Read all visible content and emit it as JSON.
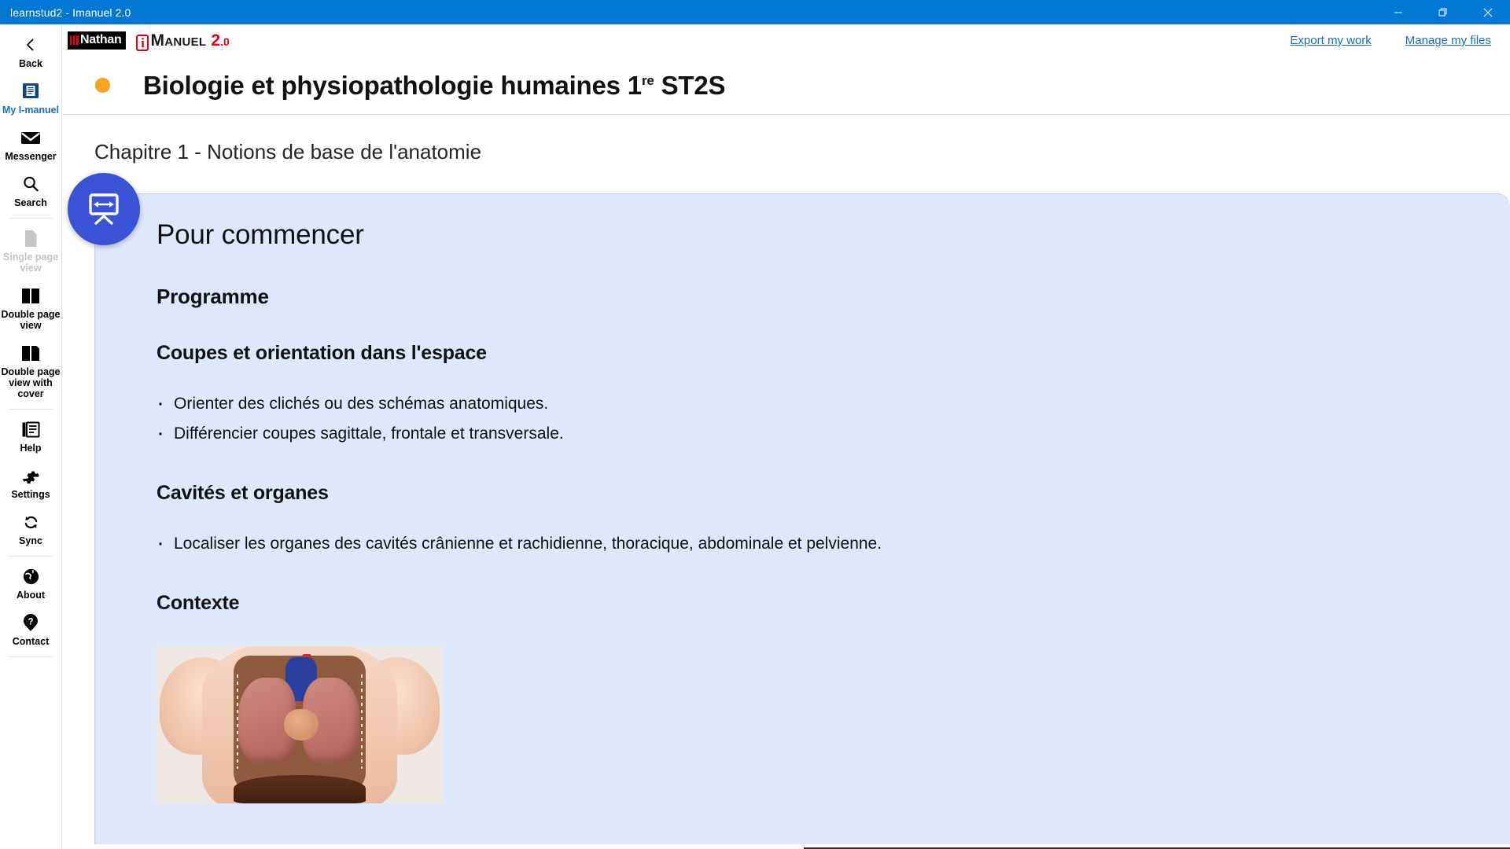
{
  "window": {
    "title": "learnstud2 - Imanuel 2.0",
    "controls": [
      {
        "name": "minimize",
        "glyph": "minimize-icon"
      },
      {
        "name": "restore",
        "glyph": "restore-icon"
      },
      {
        "name": "close",
        "glyph": "close-icon"
      }
    ],
    "titlebar_color": "#0078d4"
  },
  "sidebar": {
    "items": [
      {
        "label": "Back",
        "icon": "chevron-left-icon",
        "state": "normal"
      },
      {
        "label": "My I-manuel",
        "icon": "book-icon",
        "state": "active"
      },
      {
        "label": "Messenger",
        "icon": "envelope-icon",
        "state": "normal"
      },
      {
        "label": "Search",
        "icon": "search-icon",
        "state": "normal"
      },
      {
        "label": "Single page view",
        "icon": "single-page-icon",
        "state": "disabled"
      },
      {
        "label": "Double page view",
        "icon": "double-page-icon",
        "state": "normal"
      },
      {
        "label": "Double page view with cover",
        "icon": "double-page-cover-icon",
        "state": "normal"
      },
      {
        "label": "Help",
        "icon": "help-book-icon",
        "state": "normal"
      },
      {
        "label": "Settings",
        "icon": "gear-icon",
        "state": "normal"
      },
      {
        "label": "Sync",
        "icon": "sync-icon",
        "state": "normal"
      },
      {
        "label": "About",
        "icon": "globe-icon",
        "state": "normal"
      },
      {
        "label": "Contact",
        "icon": "question-mark-icon",
        "state": "normal"
      }
    ],
    "active_color": "#1a6fc4",
    "disabled_color": "#c6c6c6"
  },
  "header": {
    "brand": {
      "publisher": "Nathan",
      "product_i": "i",
      "product_word": "Manuel",
      "product_version_major": "2",
      "product_version_minor": ".0",
      "accent_color": "#e2001a"
    },
    "links": [
      {
        "label": "Export my work"
      },
      {
        "label": "Manage my files"
      }
    ],
    "link_color": "#1a6fc4"
  },
  "book": {
    "dot_color": "#f5a623",
    "title_main": "Biologie et physiopathologie humaines 1",
    "title_sup": "re",
    "title_tail": " ST2S"
  },
  "chapter": {
    "label": "Chapitre 1 - Notions de base de l'anatomie"
  },
  "float_button": {
    "icon": "whiteboard-resize-icon",
    "color": "#3a53d6"
  },
  "content": {
    "panel_background": "#dfe8fa",
    "heading_main": "Pour commencer",
    "sections": [
      {
        "heading": "Programme"
      },
      {
        "heading": "Coupes et orientation dans l'espace",
        "bullets": [
          "Orienter des clichés ou des schémas anatomiques.",
          "Différencier coupes sagittale, frontale et transversale."
        ]
      },
      {
        "heading": "Cavités et organes",
        "bullets": [
          "Localiser les organes des cavités crânienne et rachidienne, thoracique, abdominale et pelvienne."
        ]
      },
      {
        "heading": "Contexte"
      }
    ],
    "illustration": {
      "name": "anatomical-torso-model"
    }
  }
}
